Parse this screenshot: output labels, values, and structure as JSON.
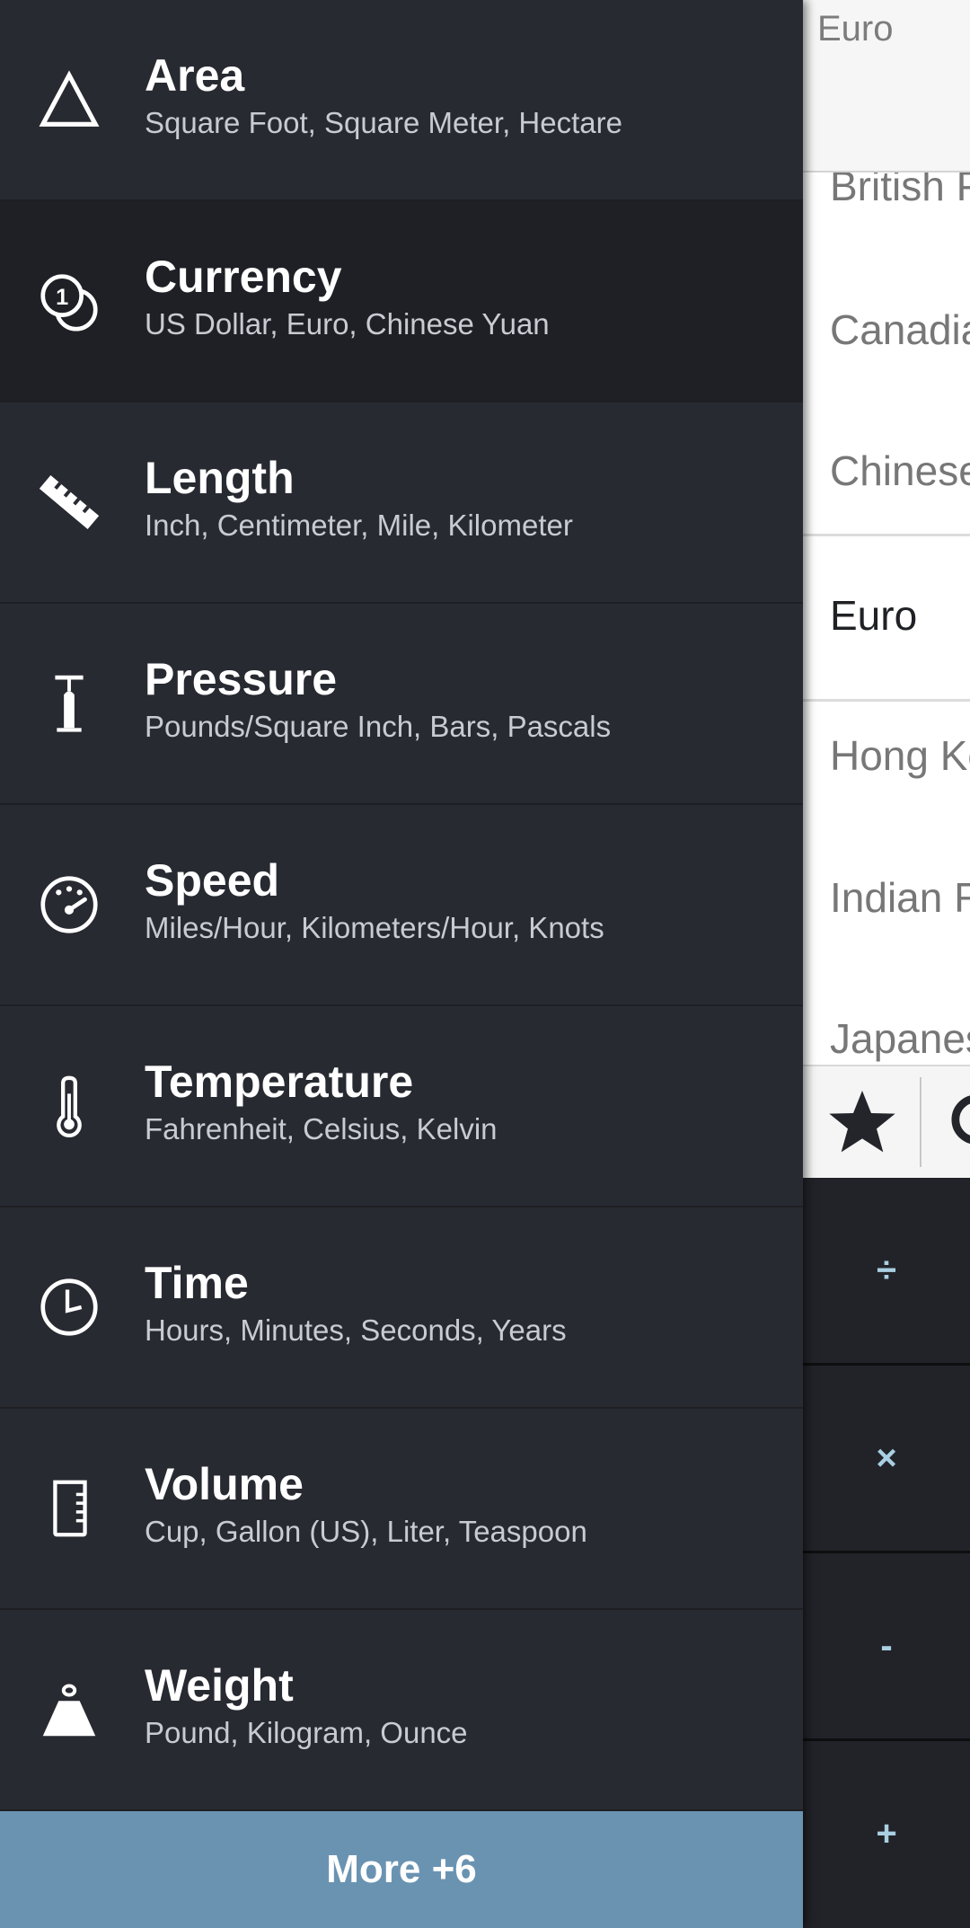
{
  "drawer": {
    "items": [
      {
        "title": "Area",
        "subtitle": "Square Foot, Square Meter, Hectare",
        "icon": "triangle-icon"
      },
      {
        "title": "Currency",
        "subtitle": "US Dollar, Euro, Chinese Yuan",
        "icon": "coins-icon",
        "active": true
      },
      {
        "title": "Length",
        "subtitle": "Inch, Centimeter, Mile, Kilometer",
        "icon": "ruler-icon"
      },
      {
        "title": "Pressure",
        "subtitle": "Pounds/Square Inch, Bars, Pascals",
        "icon": "pump-icon"
      },
      {
        "title": "Speed",
        "subtitle": "Miles/Hour, Kilometers/Hour, Knots",
        "icon": "speedometer-icon"
      },
      {
        "title": "Temperature",
        "subtitle": "Fahrenheit, Celsius, Kelvin",
        "icon": "thermometer-icon"
      },
      {
        "title": "Time",
        "subtitle": "Hours, Minutes, Seconds, Years",
        "icon": "clock-icon"
      },
      {
        "title": "Volume",
        "subtitle": "Cup, Gallon (US), Liter, Teaspoon",
        "icon": "beaker-icon"
      },
      {
        "title": "Weight",
        "subtitle": "Pound, Kilogram, Ounce",
        "icon": "weight-icon"
      }
    ],
    "more_label": "More +6"
  },
  "background": {
    "header_label": "Euro",
    "currency_list": [
      "British P",
      "Canadia",
      "Chinese",
      "Euro",
      "Hong Ko",
      "Indian R",
      "Japanes"
    ],
    "selected": "Euro",
    "operators": [
      "÷",
      "×",
      "-",
      "+"
    ]
  },
  "colors": {
    "drawer_bg": "#282a32",
    "active_row_bg": "#1f2026",
    "more_bg": "#6a93b2",
    "operator_color": "#a9cfe2"
  }
}
